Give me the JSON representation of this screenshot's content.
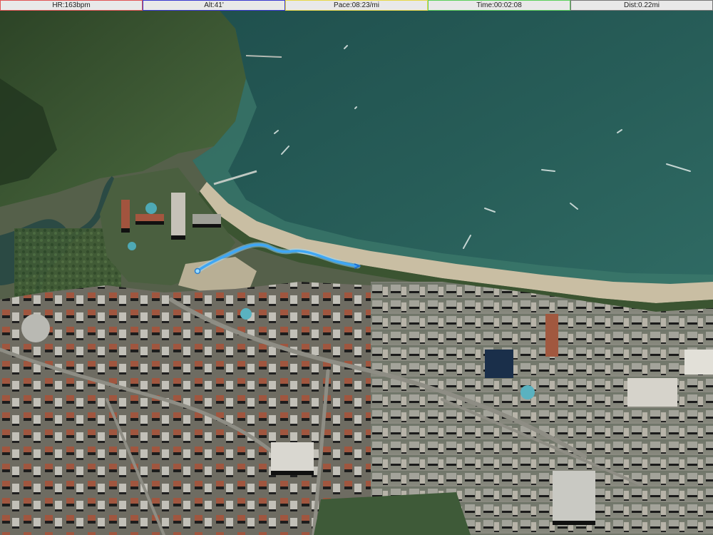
{
  "metrics": [
    {
      "id": "heart-rate",
      "text": "HR:163bpm",
      "accent": "#e05555"
    },
    {
      "id": "altitude",
      "text": "Alt:41'",
      "accent": "#3a3ad0"
    },
    {
      "id": "pace",
      "text": "Pace:08:23/mi",
      "accent": "#e8d84a"
    },
    {
      "id": "time",
      "text": "Time:00:02:08",
      "accent": "#5ccf5c"
    },
    {
      "id": "distance",
      "text": "Dist:0.22mi",
      "accent": "#777777"
    }
  ],
  "map": {
    "view": "3D satellite",
    "colors": {
      "sea": "#275d58",
      "sea_deep": "#1f4f4d",
      "beach": "#c9bea3",
      "vegetation": "#3f5a34",
      "urban": "#7c7c72",
      "route": "#3fa7f5",
      "route_glow": "#9bdcff"
    }
  }
}
